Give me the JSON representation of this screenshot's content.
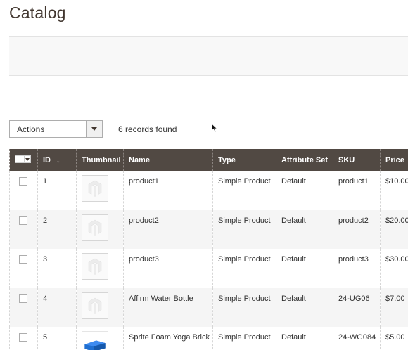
{
  "page": {
    "title": "Catalog"
  },
  "toolbar": {
    "actions_label": "Actions",
    "records_found": "6 records found"
  },
  "grid": {
    "columns": {
      "id": "ID",
      "id_sort": "↓",
      "thumbnail": "Thumbnail",
      "name": "Name",
      "type": "Type",
      "attribute_set": "Attribute Set",
      "sku": "SKU",
      "price": "Price"
    },
    "rows": [
      {
        "id": "1",
        "name": "product1",
        "type": "Simple Product",
        "attribute_set": "Default",
        "sku": "product1",
        "price": "$10.00",
        "thumbnail": "placeholder-icon"
      },
      {
        "id": "2",
        "name": "product2",
        "type": "Simple Product",
        "attribute_set": "Default",
        "sku": "product2",
        "price": "$20.00",
        "thumbnail": "placeholder-icon"
      },
      {
        "id": "3",
        "name": "product3",
        "type": "Simple Product",
        "attribute_set": "Default",
        "sku": "product3",
        "price": "$30.00",
        "thumbnail": "placeholder-icon"
      },
      {
        "id": "4",
        "name": "Affirm Water Bottle",
        "type": "Simple Product",
        "attribute_set": "Default",
        "sku": "24-UG06",
        "price": "$7.00",
        "thumbnail": "placeholder-icon"
      },
      {
        "id": "5",
        "name": "Sprite Foam Yoga Brick",
        "type": "Simple Product",
        "attribute_set": "Default",
        "sku": "24-WG084",
        "price": "$5.00",
        "thumbnail": "yoga-brick-image"
      }
    ]
  },
  "colors": {
    "header_bg": "#514943",
    "title": "#41362f",
    "row_alt": "#f5f5f5"
  }
}
